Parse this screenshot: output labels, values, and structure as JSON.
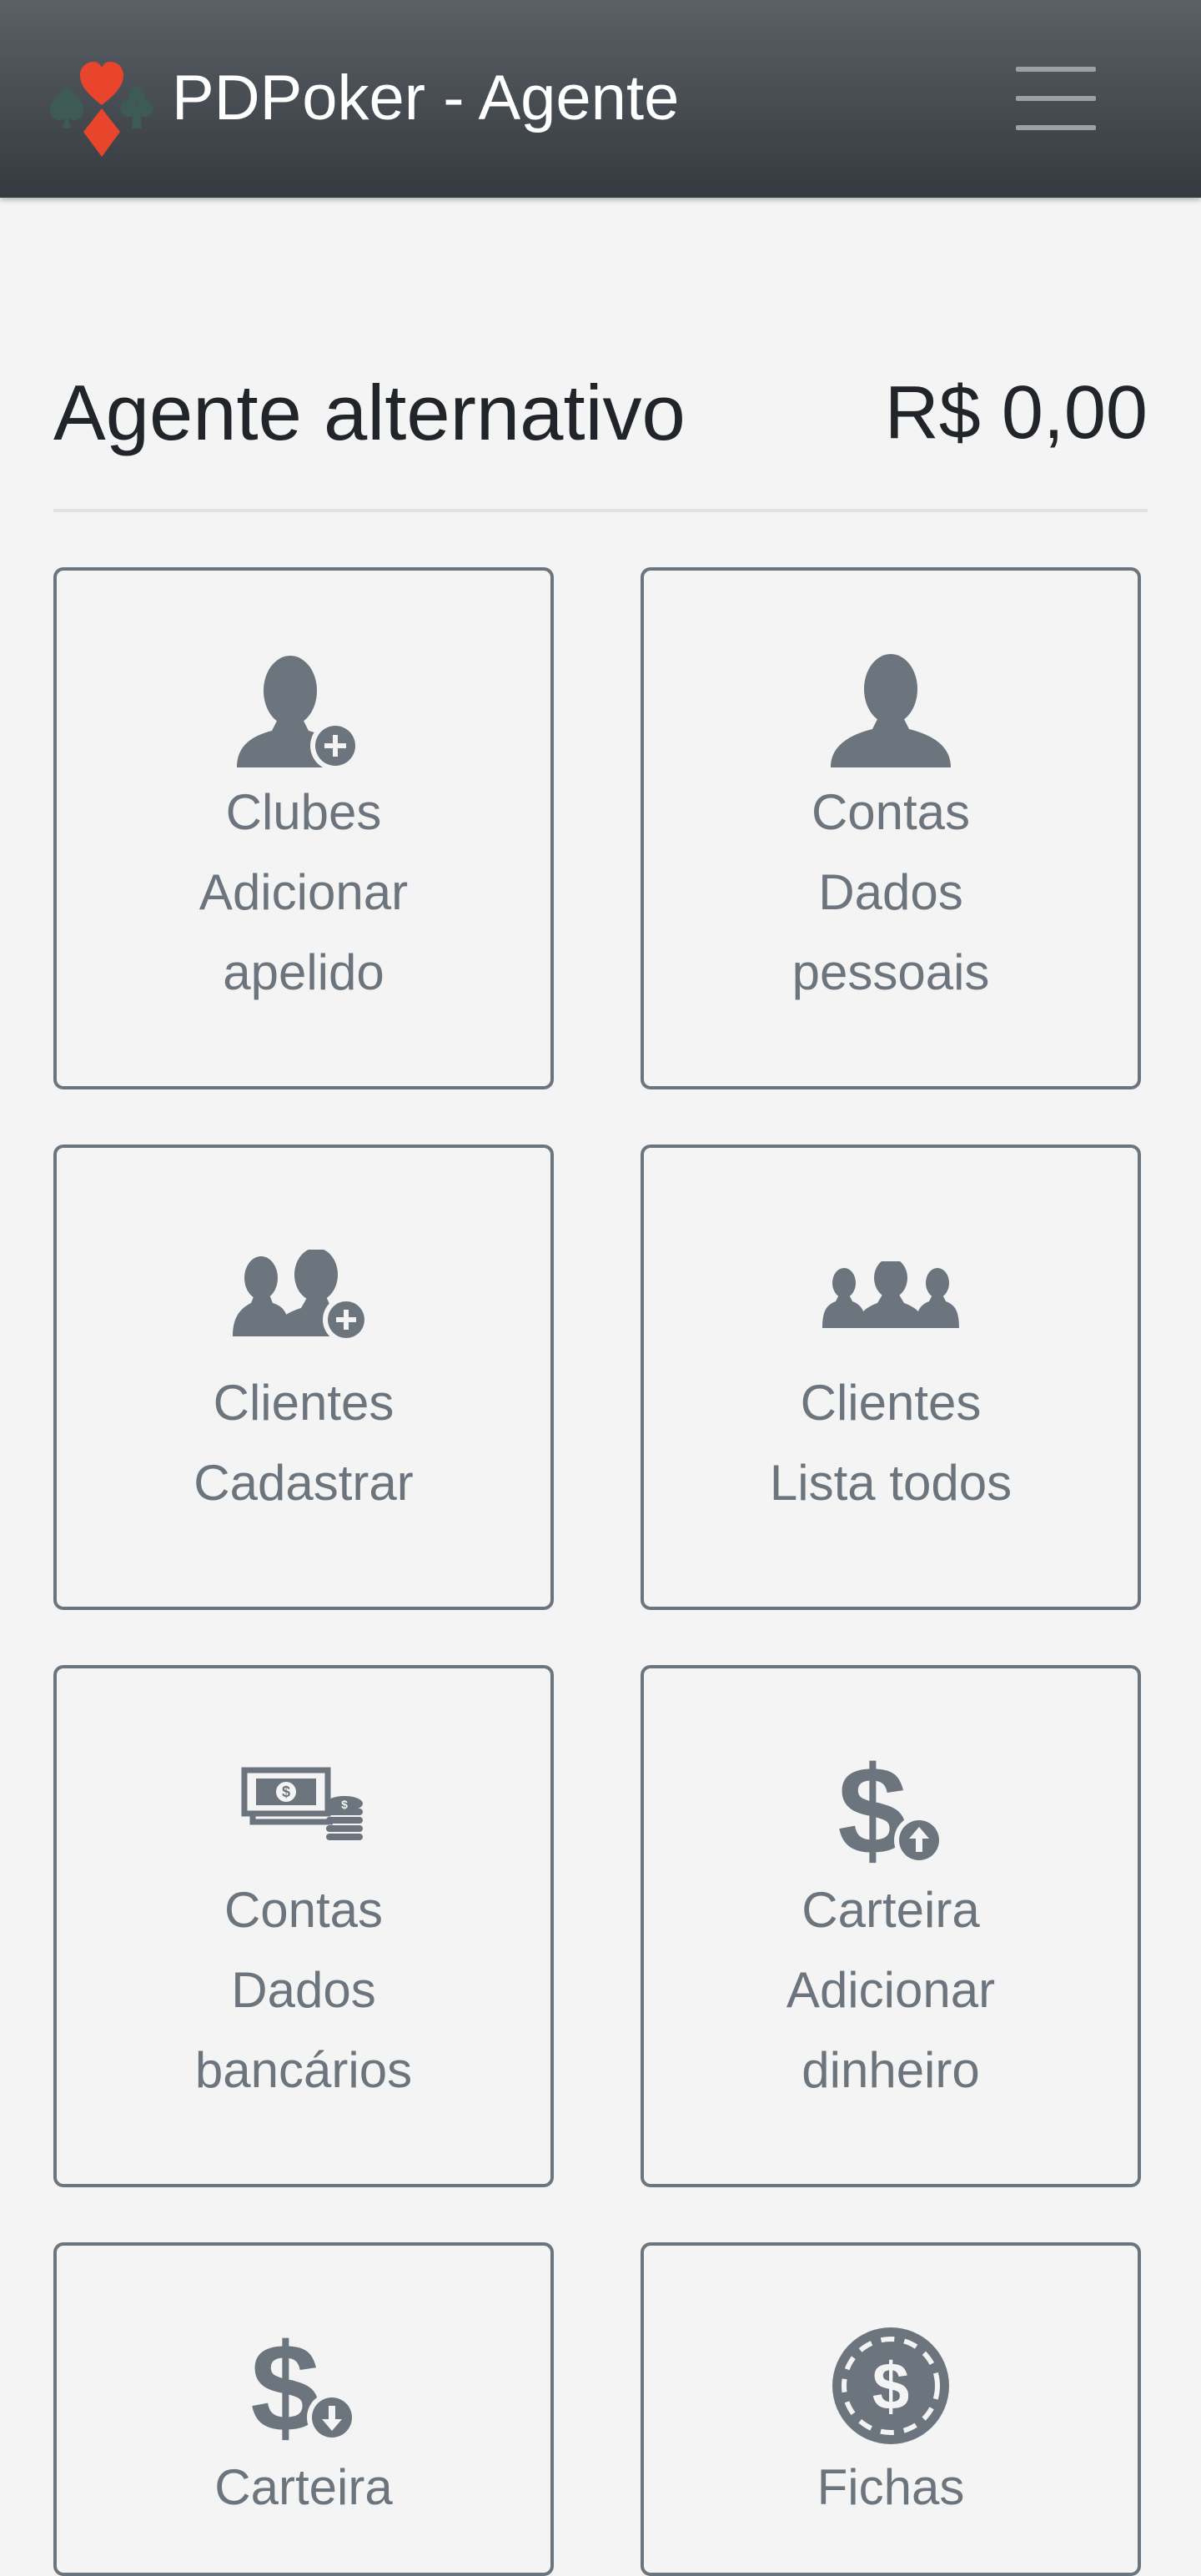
{
  "navbar": {
    "title": "PDPoker - Agente",
    "logo_icon": "poker-suits-logo",
    "menu_icon": "hamburger-menu-icon"
  },
  "header": {
    "title": "Agente alternativo",
    "balance": "R$ 0,00"
  },
  "cards": [
    {
      "icon": "user-plus-icon",
      "lines": [
        "Clubes",
        "Adicionar",
        "apelido"
      ]
    },
    {
      "icon": "user-icon",
      "lines": [
        "Contas",
        "Dados",
        "pessoais"
      ]
    },
    {
      "icon": "users-plus-icon",
      "lines": [
        "Clientes",
        "Cadastrar"
      ]
    },
    {
      "icon": "users-icon",
      "lines": [
        "Clientes",
        "Lista todos"
      ]
    },
    {
      "icon": "money-bill-coins-icon",
      "lines": [
        "Contas",
        "Dados",
        "bancários"
      ]
    },
    {
      "icon": "dollar-upload-icon",
      "lines": [
        "Carteira",
        "Adicionar",
        "dinheiro"
      ]
    },
    {
      "icon": "dollar-download-icon",
      "lines": [
        "Carteira"
      ]
    },
    {
      "icon": "poker-chip-dollar-icon",
      "lines": [
        "Fichas"
      ]
    }
  ],
  "colors": {
    "navbar_top": "#5b6066",
    "navbar_bottom": "#343a40",
    "card_border": "#6c757d",
    "card_text": "#6c757d",
    "logo_red": "#e8452c",
    "logo_dark": "#3d5a55",
    "background": "#f4f4f4"
  }
}
